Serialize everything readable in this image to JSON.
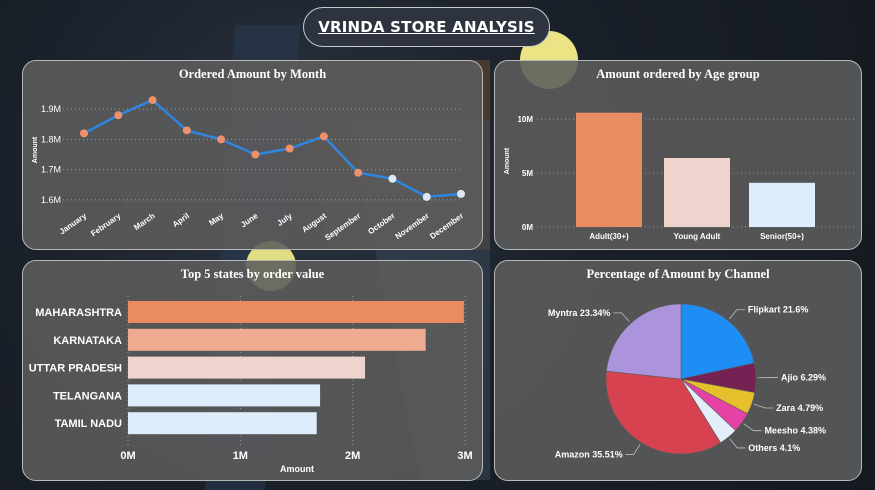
{
  "dashboard_title": "VRINDA STORE ANALYSIS",
  "colors": {
    "line": "#2f86e0",
    "marker_orange": "#f0906a",
    "marker_light": "#dce8f5",
    "bar_orange": "#ea8c62",
    "bar_salmon": "#efab8f",
    "bar_pink": "#eed4cc",
    "bar_light": "#ddedfb",
    "pie_flipkart": "#1e8df5",
    "pie_ajio": "#742253",
    "pie_zara": "#e6bf2c",
    "pie_meesho": "#e442a4",
    "pie_others": "#e3eefa",
    "pie_amazon": "#d6424f",
    "pie_myntra": "#ab94dc"
  },
  "chart_data": [
    {
      "type": "line",
      "title": "Ordered Amount by Month",
      "ylabel": "Amount",
      "x": [
        "January",
        "February",
        "March",
        "April",
        "May",
        "June",
        "July",
        "August",
        "September",
        "October",
        "November",
        "December"
      ],
      "values": [
        1.82,
        1.88,
        1.93,
        1.83,
        1.8,
        1.75,
        1.77,
        1.81,
        1.69,
        1.67,
        1.61,
        1.62
      ],
      "yticks": [
        1.6,
        1.7,
        1.8,
        1.9
      ],
      "ytick_labels": [
        "1.6M",
        "1.7M",
        "1.8M",
        "1.9M"
      ],
      "ylim": [
        1.57,
        1.96
      ],
      "grid": true
    },
    {
      "type": "bar",
      "title": "Amount ordered by Age group",
      "ylabel": "Amount",
      "categories": [
        "Adult(30+)",
        "Young Adult",
        "Senior(50+)"
      ],
      "values": [
        10.6,
        6.4,
        4.1
      ],
      "yticks": [
        0,
        5,
        10
      ],
      "ytick_labels": [
        "0M",
        "5M",
        "10M"
      ],
      "ylim": [
        0,
        11.5
      ],
      "grid": true
    },
    {
      "type": "bar",
      "orientation": "horizontal",
      "title": "Top 5 states by order value",
      "xlabel": "Amount",
      "categories": [
        "MAHARASHTRA",
        "KARNATAKA",
        "UTTAR PRADESH",
        "TELANGANA",
        "TAMIL NADU"
      ],
      "values": [
        2.99,
        2.65,
        2.11,
        1.71,
        1.68
      ],
      "xticks": [
        0,
        1,
        2,
        3
      ],
      "xtick_labels": [
        "0M",
        "1M",
        "2M",
        "3M"
      ],
      "xlim": [
        0,
        3
      ],
      "grid": true
    },
    {
      "type": "pie",
      "title": "Percentage of Amount by Channel",
      "slices": [
        {
          "label": "Flipkart",
          "value": 21.6,
          "display": "Flipkart 21.6%"
        },
        {
          "label": "Ajio",
          "value": 6.29,
          "display": "Ajio 6.29%"
        },
        {
          "label": "Zara",
          "value": 4.79,
          "display": "Zara 4.79%"
        },
        {
          "label": "Meesho",
          "value": 4.38,
          "display": "Meesho 4.38%"
        },
        {
          "label": "Others",
          "value": 4.1,
          "display": "Others 4.1%"
        },
        {
          "label": "Amazon",
          "value": 35.51,
          "display": "Amazon 35.51%"
        },
        {
          "label": "Myntra",
          "value": 23.34,
          "display": "Myntra 23.34%"
        }
      ]
    }
  ]
}
